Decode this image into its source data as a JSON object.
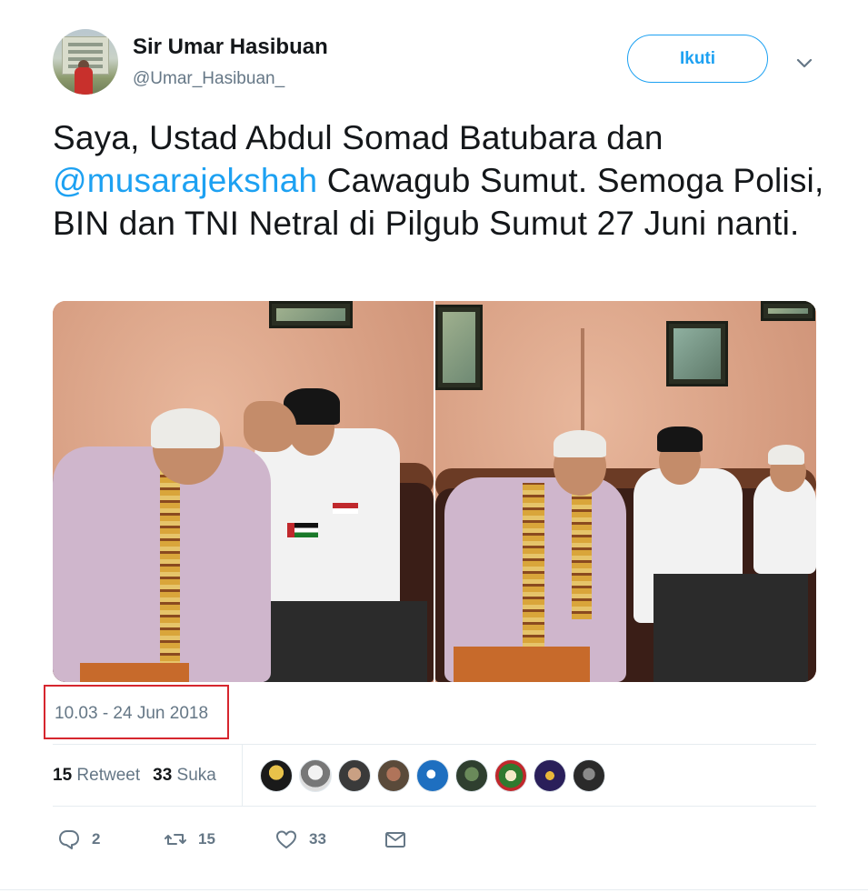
{
  "author": {
    "name": "Sir Umar Hasibuan",
    "handle": "@Umar_Hasibuan_"
  },
  "follow_button": {
    "label": "Ikuti"
  },
  "tweet": {
    "text_before": "Saya, Ustad Abdul Somad Batubara dan ",
    "mention": "@musarajekshah",
    "text_after": " Cawagub Sumut. Semoga Polisi, BIN dan TNI Netral di Pilgub Sumut 27 Juni nanti."
  },
  "timestamp": "10.03 - 24 Jun 2018",
  "stats": {
    "retweet_count": "15",
    "retweet_label": "Retweet",
    "like_count": "33",
    "like_label": "Suka"
  },
  "actions": {
    "reply_count": "2",
    "retweet_count": "15",
    "like_count": "33"
  },
  "liker_avatars": 9,
  "colors": {
    "accent": "#1da1f2",
    "muted": "#657786",
    "text": "#14171a",
    "highlight_box": "#d6262e"
  },
  "icons": [
    "chevron-down-icon",
    "reply-icon",
    "retweet-icon",
    "heart-icon",
    "mail-icon"
  ]
}
